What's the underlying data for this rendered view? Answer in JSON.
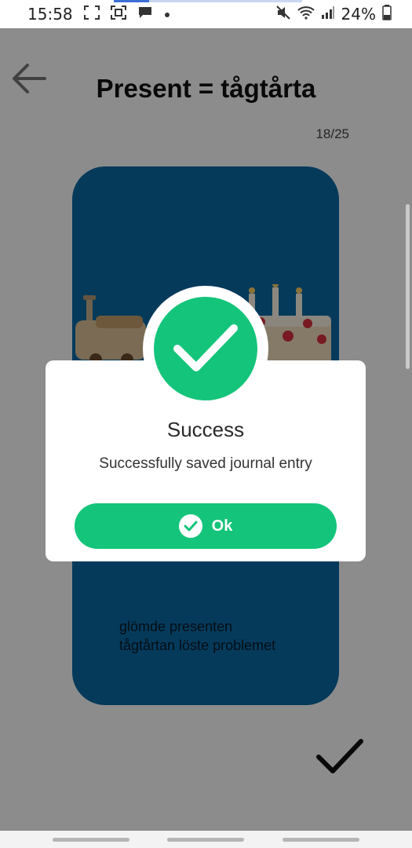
{
  "status_bar": {
    "time": "15:58",
    "battery": "24%"
  },
  "header": {
    "title": "Present = tågtårta",
    "counter": "18/25"
  },
  "card": {
    "line1": "glömde presenten",
    "line2": "tågtårtan löste problemet"
  },
  "dialog": {
    "title": "Success",
    "message": "Successfully saved journal entry",
    "ok_label": "Ok"
  },
  "colors": {
    "accent": "#14c47a",
    "card_bg": "#0a6aa6"
  }
}
